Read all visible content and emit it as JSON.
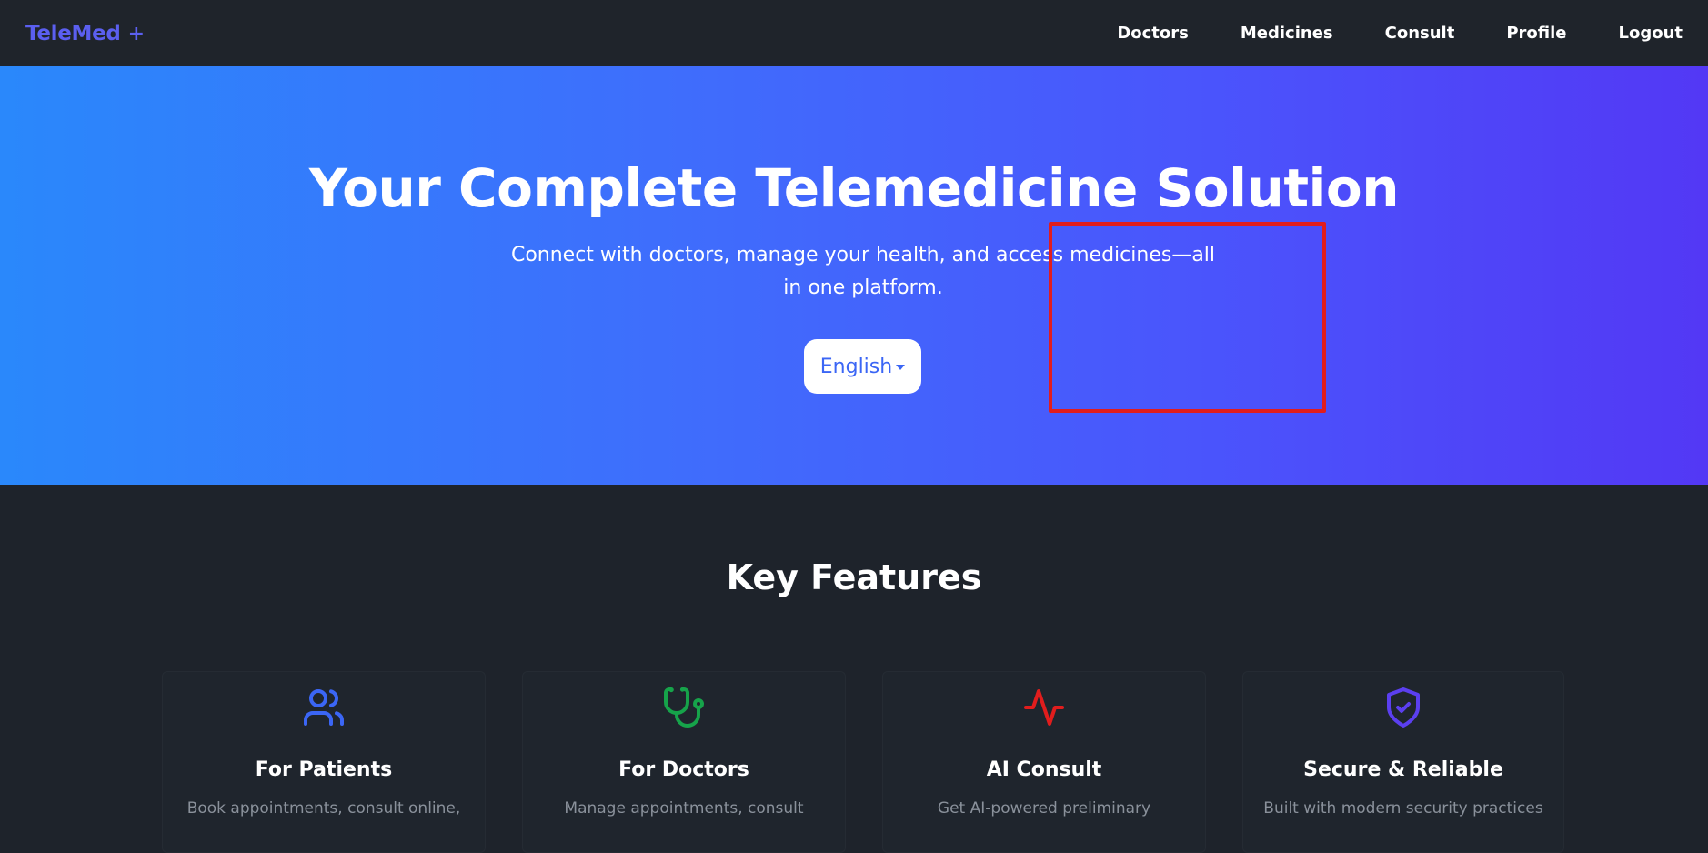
{
  "nav": {
    "brand": "TeleMed",
    "brand_plus": "+",
    "links": [
      "Doctors",
      "Medicines",
      "Consult",
      "Profile",
      "Logout"
    ]
  },
  "hero": {
    "title": "Your Complete Telemedicine Solution",
    "subtitle": "Connect with doctors, manage your health, and access medicines—all in one platform.",
    "language": "English"
  },
  "features": {
    "title": "Key Features",
    "cards": [
      {
        "title": "For Patients",
        "desc": "Book appointments, consult online,",
        "icon": "users-icon",
        "color": "#3b66f5"
      },
      {
        "title": "For Doctors",
        "desc": "Manage appointments, consult",
        "icon": "stethoscope-icon",
        "color": "#16a34a"
      },
      {
        "title": "AI Consult",
        "desc": "Get AI-powered preliminary",
        "icon": "activity-icon",
        "color": "#e11d1d"
      },
      {
        "title": "Secure & Reliable",
        "desc": "Built with modern security practices",
        "icon": "shield-check-icon",
        "color": "#5b3ff0"
      }
    ]
  },
  "colors": {
    "brand": "#5b5ff0",
    "hero_start": "#2a88fb",
    "hero_end": "#5338f5",
    "highlight": "#e11d1d"
  }
}
